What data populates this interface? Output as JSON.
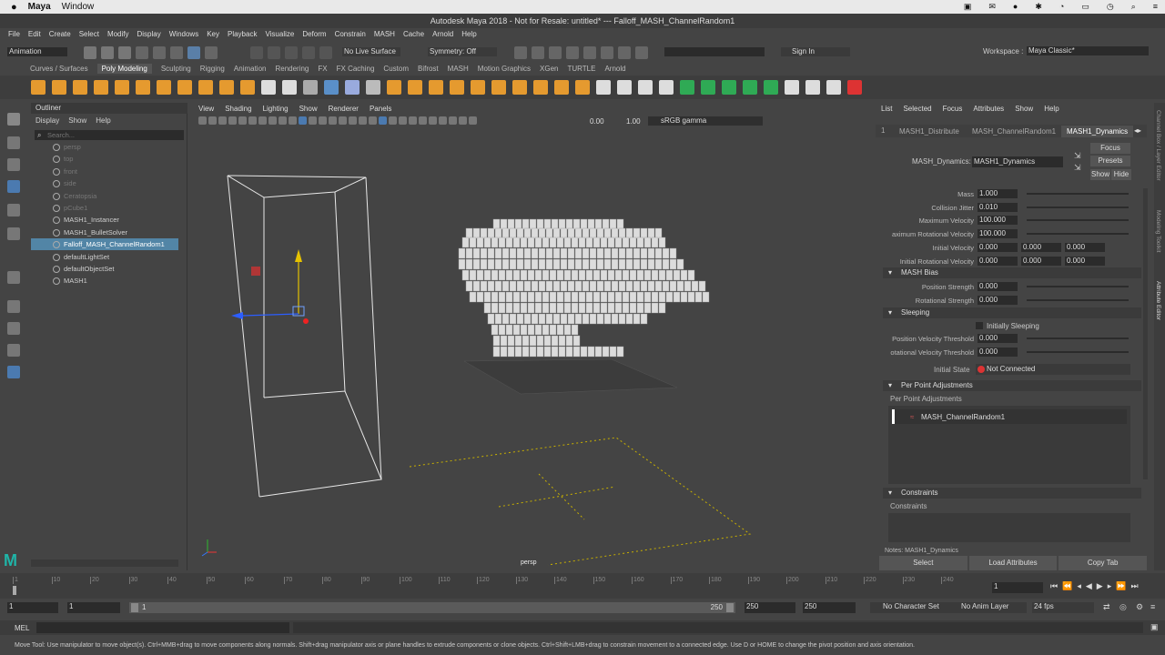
{
  "mac_bar": {
    "app": "Maya",
    "menus": [
      "Window"
    ],
    "title": "Autodesk Maya 2018 - Not for Resale: untitled*   ---   Falloff_MASH_ChannelRandom1"
  },
  "main_menu": [
    "File",
    "Edit",
    "Create",
    "Select",
    "Modify",
    "Display",
    "Windows",
    "Key",
    "Playback",
    "Visualize",
    "Deform",
    "Constrain",
    "MASH",
    "Cache",
    "Arnold",
    "Help"
  ],
  "status_line": {
    "menuset": "Animation",
    "live_surface": "No Live Surface",
    "symmetry": "Symmetry: Off",
    "sign_in": "Sign In",
    "workspace_label": "Workspace :",
    "workspace_value": "Maya Classic*"
  },
  "shelf_tabs": [
    "Curves / Surfaces",
    "Poly Modeling",
    "Sculpting",
    "Rigging",
    "Animation",
    "Rendering",
    "FX",
    "FX Caching",
    "Custom",
    "Bifrost",
    "MASH",
    "Motion Graphics",
    "XGen",
    "TURTLE",
    "Arnold"
  ],
  "active_shelf": "Poly Modeling",
  "outliner": {
    "title": "Outliner",
    "menus": [
      "Display",
      "Show",
      "Help"
    ],
    "search_placeholder": "Search...",
    "items": [
      {
        "label": "persp",
        "dim": true
      },
      {
        "label": "top",
        "dim": true
      },
      {
        "label": "front",
        "dim": true
      },
      {
        "label": "side",
        "dim": true
      },
      {
        "label": "Ceratopsia",
        "dim": true
      },
      {
        "label": "pCube1",
        "dim": true
      },
      {
        "label": "MASH1_Instancer",
        "dim": false
      },
      {
        "label": "MASH1_BulletSolver",
        "dim": false
      },
      {
        "label": "Falloff_MASH_ChannelRandom1",
        "dim": false,
        "selected": true
      },
      {
        "label": "defaultLightSet",
        "dim": false
      },
      {
        "label": "defaultObjectSet",
        "dim": false
      },
      {
        "label": "MASH1",
        "dim": false
      }
    ]
  },
  "viewport": {
    "menus": [
      "View",
      "Shading",
      "Lighting",
      "Show",
      "Renderer",
      "Panels"
    ],
    "val1": "0.00",
    "val2": "1.00",
    "colorspace": "sRGB gamma",
    "camera_label": "persp"
  },
  "attr_editor": {
    "menus": [
      "List",
      "Selected",
      "Focus",
      "Attributes",
      "Show",
      "Help"
    ],
    "tabs": [
      "MASH1_Distribute",
      "MASH_ChannelRandom1",
      "MASH1_Dynamics"
    ],
    "active_tab": "MASH1_Dynamics",
    "node_label": "MASH_Dynamics:",
    "node_value": "MASH1_Dynamics",
    "focus_btn": "Focus",
    "presets_btn": "Presets",
    "show_btn": "Show",
    "hide_btn": "Hide",
    "attrs": [
      {
        "label": "Mass",
        "values": [
          "1.000"
        ]
      },
      {
        "label": "Collision Jitter",
        "values": [
          "0.010"
        ]
      },
      {
        "label": "Maximum Velocity",
        "values": [
          "100.000"
        ]
      },
      {
        "label": "aximum Rotational Velocity",
        "values": [
          "100.000"
        ]
      },
      {
        "label": "Initial Velocity",
        "values": [
          "0.000",
          "0.000",
          "0.000"
        ]
      },
      {
        "label": "Initial Rotational Velocity",
        "values": [
          "0.000",
          "0.000",
          "0.000"
        ]
      }
    ],
    "bias_section": "MASH Bias",
    "bias_attrs": [
      {
        "label": "Position Strength",
        "values": [
          "0.000"
        ]
      },
      {
        "label": "Rotational Strength",
        "values": [
          "0.000"
        ]
      }
    ],
    "sleeping_section": "Sleeping",
    "initially_sleeping": "Initially Sleeping",
    "sleep_attrs": [
      {
        "label": "Position Velocity Threshold",
        "values": [
          "0.000"
        ]
      },
      {
        "label": "otational Velocity Threshold",
        "values": [
          "0.000"
        ]
      }
    ],
    "initial_state_label": "Initial State",
    "initial_state_value": "Not Connected",
    "ppa_section": "Per Point Adjustments",
    "ppa_label": "Per Point Adjustments",
    "ppa_item": "MASH_ChannelRandom1",
    "constraints_section": "Constraints",
    "constraints_label": "Constraints",
    "notes_label": "Notes:  MASH1_Dynamics",
    "bottom_buttons": [
      "Select",
      "Load Attributes",
      "Copy Tab"
    ],
    "side_tabs": [
      "Channel Box / Layer Editor",
      "Modeling Toolkit",
      "Attribute Editor"
    ]
  },
  "timeline": {
    "ticks": [
      "1",
      "10",
      "20",
      "30",
      "40",
      "50",
      "60",
      "70",
      "80",
      "90",
      "100",
      "110",
      "120",
      "130",
      "140",
      "150",
      "160",
      "170",
      "180",
      "190",
      "200",
      "210",
      "220",
      "230",
      "240"
    ],
    "current": "1"
  },
  "range": {
    "start": "1",
    "play_start": "1",
    "slider_start": "1",
    "slider_end": "250",
    "play_end": "250",
    "end": "250",
    "character_set": "No Character Set",
    "anim_layer": "No Anim Layer",
    "fps": "24 fps"
  },
  "command_line": {
    "label": "MEL"
  },
  "help_line": "Move Tool: Use manipulator to move object(s). Ctrl+MMB+drag to move components along normals. Shift+drag manipulator axis or plane handles to extrude components or clone objects. Ctrl+Shift+LMB+drag to constrain movement to a connected edge. Use D or HOME to change the pivot position and axis orientation."
}
